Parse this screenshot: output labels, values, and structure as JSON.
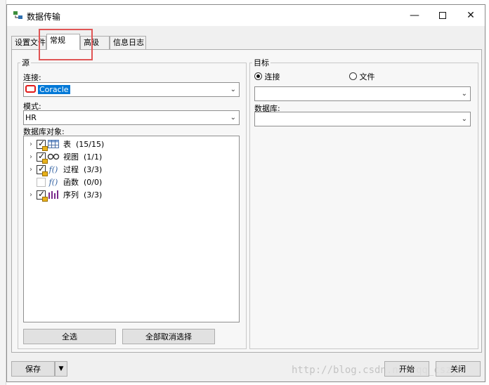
{
  "window": {
    "title": "数据传输"
  },
  "tabs": [
    {
      "label": "设置文件",
      "active": false
    },
    {
      "label": "常规",
      "active": true
    },
    {
      "label": "高级",
      "active": false
    },
    {
      "label": "信息日志",
      "active": false
    }
  ],
  "source": {
    "legend": "源",
    "connection_label": "连接:",
    "connection_value": "Coracle",
    "schema_label": "模式:",
    "schema_value": "HR",
    "objects_label": "数据库对象:",
    "objects": [
      {
        "label": "表",
        "count": "(15/15)",
        "checked": true,
        "icon": "table-icon"
      },
      {
        "label": "视图",
        "count": "(1/1)",
        "checked": true,
        "icon": "view-icon"
      },
      {
        "label": "过程",
        "count": "(3/3)",
        "checked": true,
        "icon": "procedure-icon"
      },
      {
        "label": "函数",
        "count": "(0/0)",
        "checked": false,
        "icon": "function-icon"
      },
      {
        "label": "序列",
        "count": "(3/3)",
        "checked": true,
        "icon": "sequence-icon"
      }
    ],
    "select_all": "全选",
    "deselect_all": "全部取消选择"
  },
  "target": {
    "legend": "目标",
    "radio_connection": "连接",
    "radio_file": "文件",
    "database_label": "数据库:",
    "selected_radio": "连接"
  },
  "footer": {
    "save": "保存",
    "start": "开始",
    "close": "关闭"
  },
  "watermark": "http://blog.csdn.net/qq_cszy"
}
